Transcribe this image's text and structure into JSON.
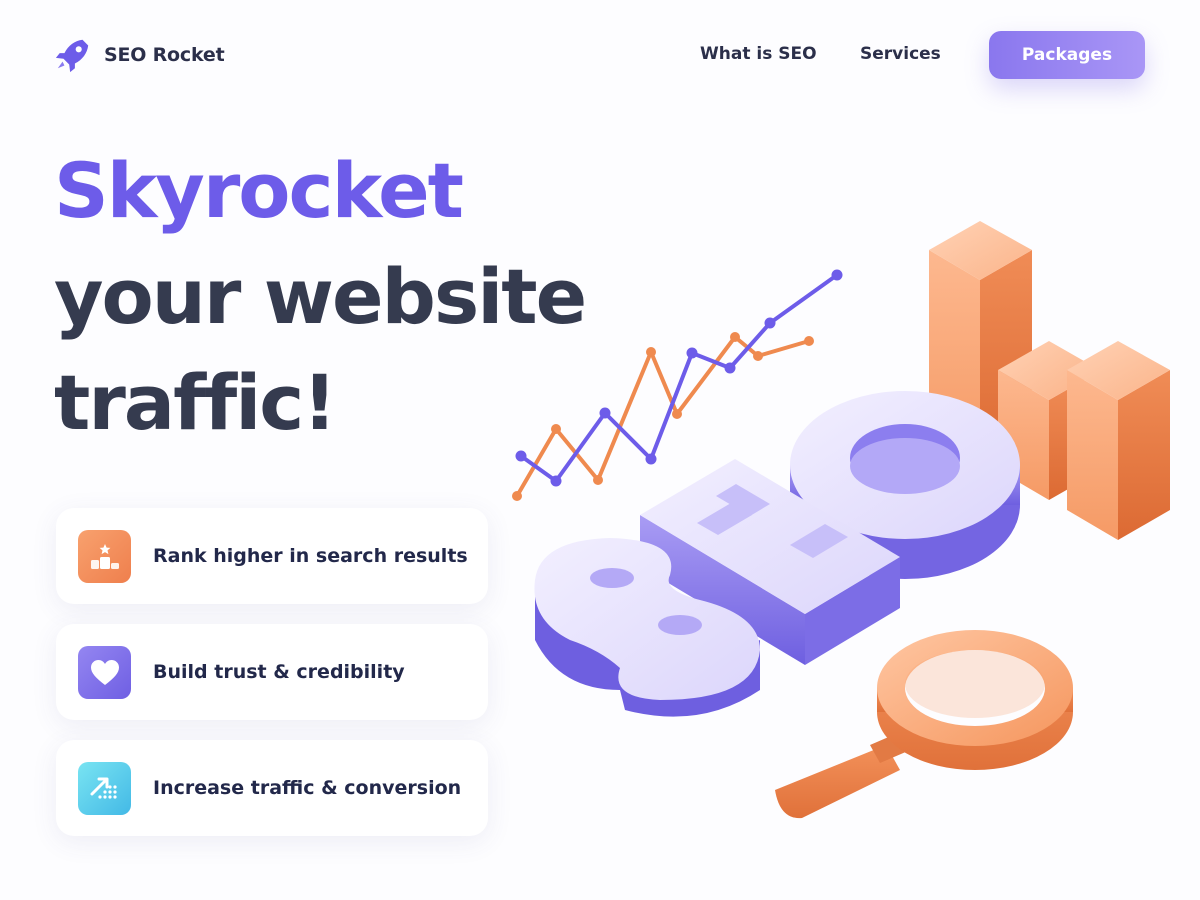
{
  "nav": {
    "brand": "SEO Rocket",
    "links": [
      "What is SEO",
      "Services"
    ],
    "cta_label": "Packages"
  },
  "hero": {
    "line1": "Skyrocket",
    "line2": "your website",
    "line3": "traffic!"
  },
  "features": [
    {
      "label": "Rank higher in search results",
      "icon": "podium-icon"
    },
    {
      "label": "Build trust & credibility",
      "icon": "heart-icon"
    },
    {
      "label": "Increase traffic & conversion",
      "icon": "growth-arrow-icon"
    }
  ],
  "illustration": {
    "word": "SEO"
  },
  "colors": {
    "accent": "#6d5ce9",
    "dark_text": "#353b4f",
    "orange": "#ef7f4d",
    "button_start": "#8a77ee",
    "button_end": "#a996f6"
  }
}
